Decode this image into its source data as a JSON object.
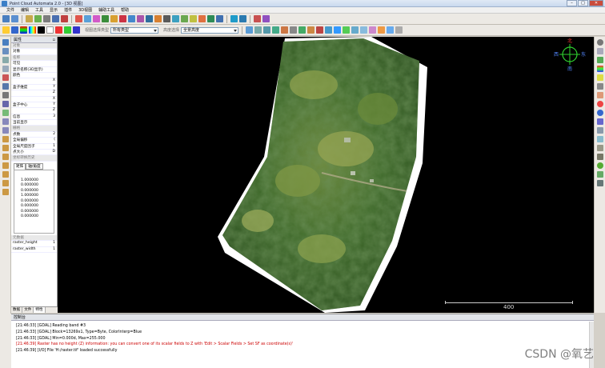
{
  "window": {
    "title": "Point Cloud Automata 2.0 - [3D 视图]",
    "minimize": "–",
    "maximize": "□",
    "close": "✕"
  },
  "menu": [
    "文件",
    "编辑",
    "工具",
    "显示",
    "插件",
    "3D视图",
    "辅助工具",
    "帮助"
  ],
  "toolbar2": {
    "sel_label": "视图选择类型",
    "sel_value": "所有类型",
    "std_label": "高度选择",
    "std_value": "全景高度"
  },
  "panel": {
    "title": "属性",
    "pin": "▫",
    "rows": [
      {
        "k": "对象",
        "v": "",
        "sec": true
      },
      {
        "k": "对象",
        "v": ""
      },
      {
        "k": "名称",
        "v": "",
        "sec": true
      },
      {
        "k": "可见",
        "v": ""
      },
      {
        "k": "显示名称(3D显示)",
        "v": ""
      },
      {
        "k": "颜色",
        "v": ""
      },
      {
        "k": "",
        "v": "X"
      },
      {
        "k": "盒子维度",
        "v": "Y"
      },
      {
        "k": "",
        "v": "Z"
      },
      {
        "k": "",
        "v": "X"
      },
      {
        "k": "盒子中心",
        "v": "Y"
      },
      {
        "k": "",
        "v": "Z"
      },
      {
        "k": "信息",
        "v": "3"
      },
      {
        "k": "当前显示",
        "v": ""
      },
      {
        "k": "栅格",
        "v": "",
        "sec": true
      },
      {
        "k": "点数",
        "v": "2"
      },
      {
        "k": "全局偏移",
        "v": "("
      },
      {
        "k": "全局尺度因子",
        "v": "1"
      },
      {
        "k": "点大小",
        "v": "D"
      },
      {
        "k": "坐标转换历史",
        "v": "",
        "sec": true
      }
    ],
    "tabs": [
      "矩阵",
      "轴/角度"
    ],
    "matrix": [
      "1.000000 0.000000",
      "0.000000 1.000000",
      "0.000000 0.000000",
      "0.000000 0.000000"
    ],
    "meta_title": "元数据",
    "meta": [
      {
        "k": "raster_height",
        "v": "1"
      },
      {
        "k": "raster_width",
        "v": "1"
      }
    ],
    "bottom_tabs": [
      "数据",
      "文件",
      "特性"
    ]
  },
  "viewport": {
    "compass_north": "北",
    "compass_south": "南",
    "compass_west": "西",
    "compass_east": "东",
    "scale_label": "400"
  },
  "console": {
    "title": "控制台",
    "lines": [
      {
        "t": "[21:46:33] [GDAL] Reading band #3",
        "err": false
      },
      {
        "t": "[21:46:33] [GDAL] Block=13269x1, Type=Byte, ColorInterp=Blue",
        "err": false
      },
      {
        "t": "[21:46:33] [GDAL] Min=0.000d, Max=255.000",
        "err": false
      },
      {
        "t": "[21:46:39] Raster has no height (Z) information: you can convert one of its scalar fields to Z with 'Edit > Scalar Fields > Set SF as coordinate(s)'",
        "err": true
      },
      {
        "t": "[21:46:39] [I/O] File 'H:/raster.tif' loaded successfully",
        "err": false
      }
    ]
  },
  "watermark": "CSDN @氧艺"
}
